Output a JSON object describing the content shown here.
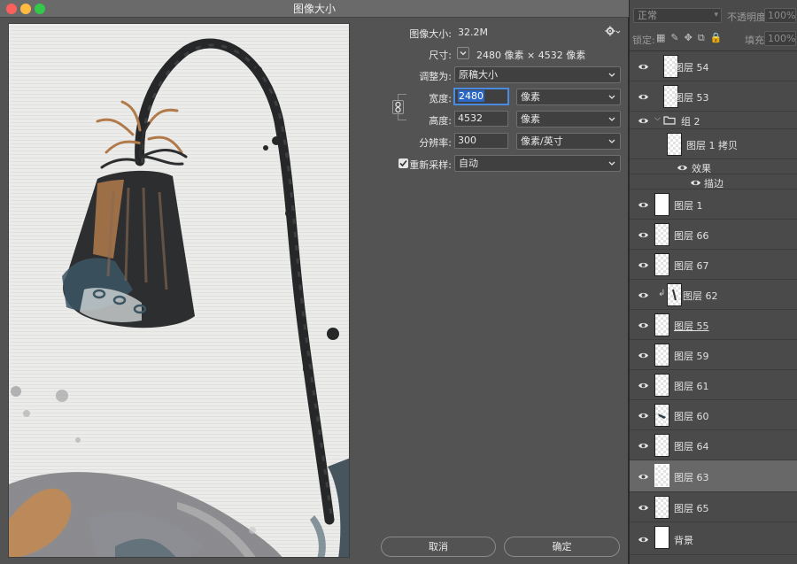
{
  "window": {
    "title": "图像大小",
    "traffic_lights": [
      "#fc605c",
      "#fdbc40",
      "#34c84a"
    ]
  },
  "dialog": {
    "image_size_label": "图像大小:",
    "image_size_value": "32.2M",
    "dimensions_label": "尺寸:",
    "dimensions_value": "2480 像素 × 4532 像素",
    "fit_to_label": "调整为:",
    "fit_to_value": "原稿大小",
    "width_label": "宽度:",
    "width_value": "2480",
    "width_unit": "像素",
    "height_label": "高度:",
    "height_value": "4532",
    "height_unit": "像素",
    "resolution_label": "分辨率:",
    "resolution_value": "300",
    "resolution_unit": "像素/英寸",
    "resample_label": "重新采样:",
    "resample_checked": true,
    "resample_value": "自动",
    "cancel_label": "取消",
    "ok_label": "确定",
    "settings_icon": "gear-icon",
    "link_icon": "chain-link-icon"
  },
  "layers_panel": {
    "blend_mode": "正常",
    "opacity_label": "不透明度:",
    "opacity_value": "100%",
    "lock_label": "锁定:",
    "fill_label": "填充:",
    "fill_value": "100%",
    "layers": [
      {
        "name": "图层 54"
      },
      {
        "name": "图层 53"
      },
      {
        "name": "组 2"
      },
      {
        "name": "图层 1 拷贝"
      },
      {
        "name": "效果"
      },
      {
        "name": "描边"
      },
      {
        "name": "图层 1"
      },
      {
        "name": "图层 66"
      },
      {
        "name": "图层 67"
      },
      {
        "name": "图层 62"
      },
      {
        "name": "图层 55"
      },
      {
        "name": "图层 59"
      },
      {
        "name": "图层 61"
      },
      {
        "name": "图层 60"
      },
      {
        "name": "图层 64"
      },
      {
        "name": "图层 63"
      },
      {
        "name": "图层 65"
      },
      {
        "name": "背景"
      }
    ]
  }
}
